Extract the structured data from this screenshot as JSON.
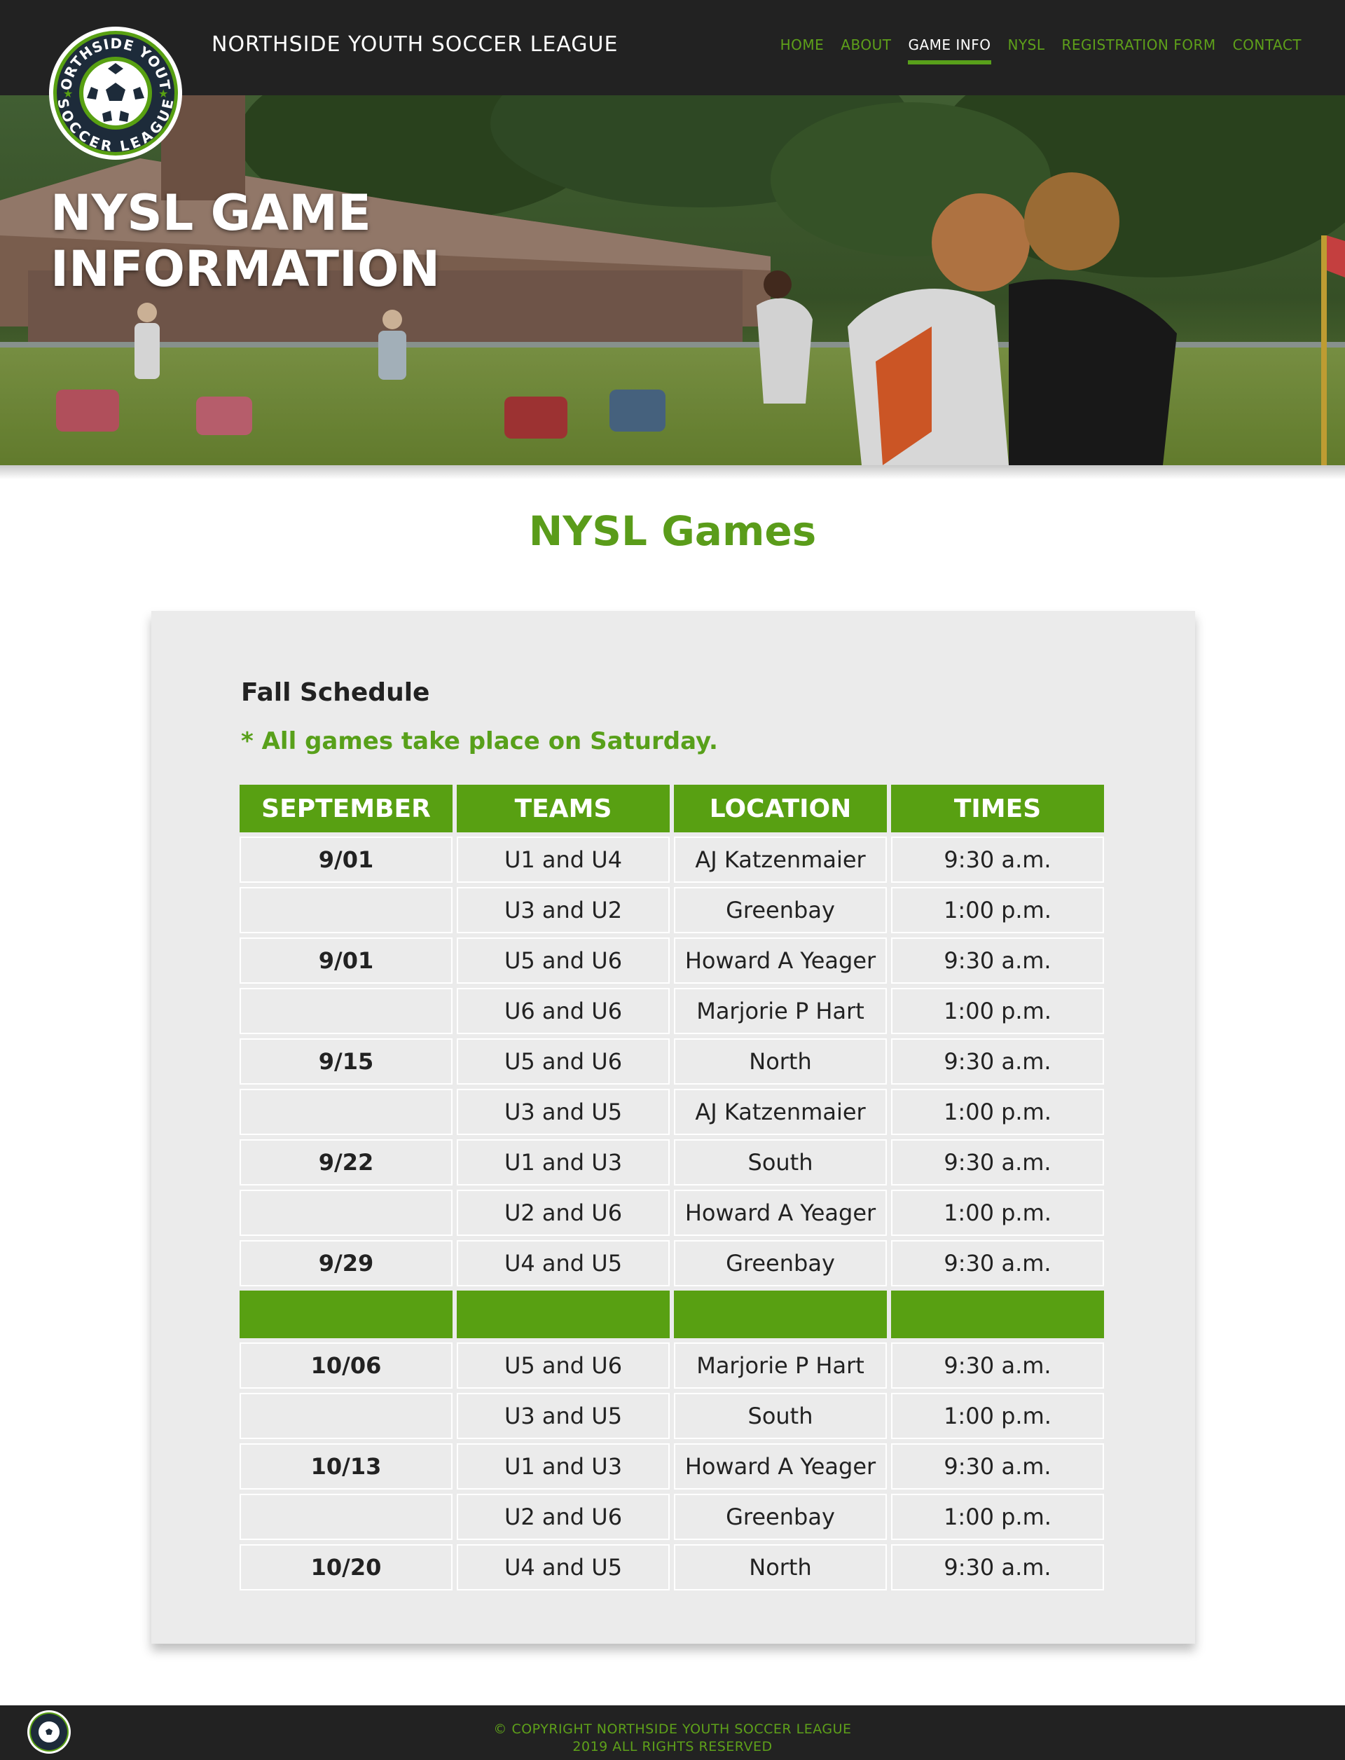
{
  "header": {
    "site_title": "NORTHSIDE YOUTH SOCCER LEAGUE",
    "nav": [
      {
        "label": "HOME",
        "active": false
      },
      {
        "label": "ABOUT",
        "active": false
      },
      {
        "label": "GAME INFO",
        "active": true
      },
      {
        "label": "NYSL",
        "active": false
      },
      {
        "label": "REGISTRATION FORM",
        "active": false
      },
      {
        "label": "CONTACT",
        "active": false
      }
    ],
    "logo": {
      "top_text": "NORTHSIDE YOUTH",
      "bottom_text": "SOCCER LEAGUE"
    }
  },
  "hero": {
    "title_line1": "NYSL GAME",
    "title_line2": "INFORMATION"
  },
  "main": {
    "heading": "NYSL Games",
    "schedule_title": "Fall Schedule",
    "note": "* All games take place on Saturday.",
    "columns": [
      "SEPTEMBER",
      "TEAMS",
      "LOCATION",
      "TIMES"
    ],
    "september": [
      {
        "date": "9/01",
        "teams": "U1 and U4",
        "location": "AJ Katzenmaier",
        "time": "9:30 a.m."
      },
      {
        "date": "",
        "teams": "U3 and U2",
        "location": "Greenbay",
        "time": "1:00 p.m."
      },
      {
        "date": "9/01",
        "teams": "U5 and U6",
        "location": "Howard A Yeager",
        "time": "9:30 a.m."
      },
      {
        "date": "",
        "teams": "U6 and U6",
        "location": "Marjorie P Hart",
        "time": "1:00 p.m."
      },
      {
        "date": "9/15",
        "teams": "U5 and U6",
        "location": "North",
        "time": "9:30 a.m."
      },
      {
        "date": "",
        "teams": "U3 and U5",
        "location": "AJ Katzenmaier",
        "time": "1:00 p.m."
      },
      {
        "date": "9/22",
        "teams": "U1 and U3",
        "location": "South",
        "time": "9:30 a.m."
      },
      {
        "date": "",
        "teams": "U2 and U6",
        "location": "Howard A Yeager",
        "time": "1:00 p.m."
      },
      {
        "date": "9/29",
        "teams": "U4 and U5",
        "location": "Greenbay",
        "time": "9:30 a.m."
      }
    ],
    "october": [
      {
        "date": "10/06",
        "teams": "U5 and U6",
        "location": "Marjorie P Hart",
        "time": "9:30 a.m."
      },
      {
        "date": "",
        "teams": "U3 and U5",
        "location": "South",
        "time": "1:00 p.m."
      },
      {
        "date": "10/13",
        "teams": "U1 and U3",
        "location": "Howard A Yeager",
        "time": "9:30 a.m."
      },
      {
        "date": "",
        "teams": "U2 and U6",
        "location": "Greenbay",
        "time": "1:00 p.m."
      },
      {
        "date": "10/20",
        "teams": "U4 and U5",
        "location": "North",
        "time": "9:30 a.m."
      }
    ]
  },
  "footer": {
    "line1": "© COPYRIGHT NORTHSIDE YOUTH SOCCER LEAGUE",
    "line2": "2019 ALL RIGHTS RESERVED"
  },
  "colors": {
    "brand_green": "#58a012",
    "header_bg": "#222222",
    "card_bg": "#ebebeb"
  }
}
